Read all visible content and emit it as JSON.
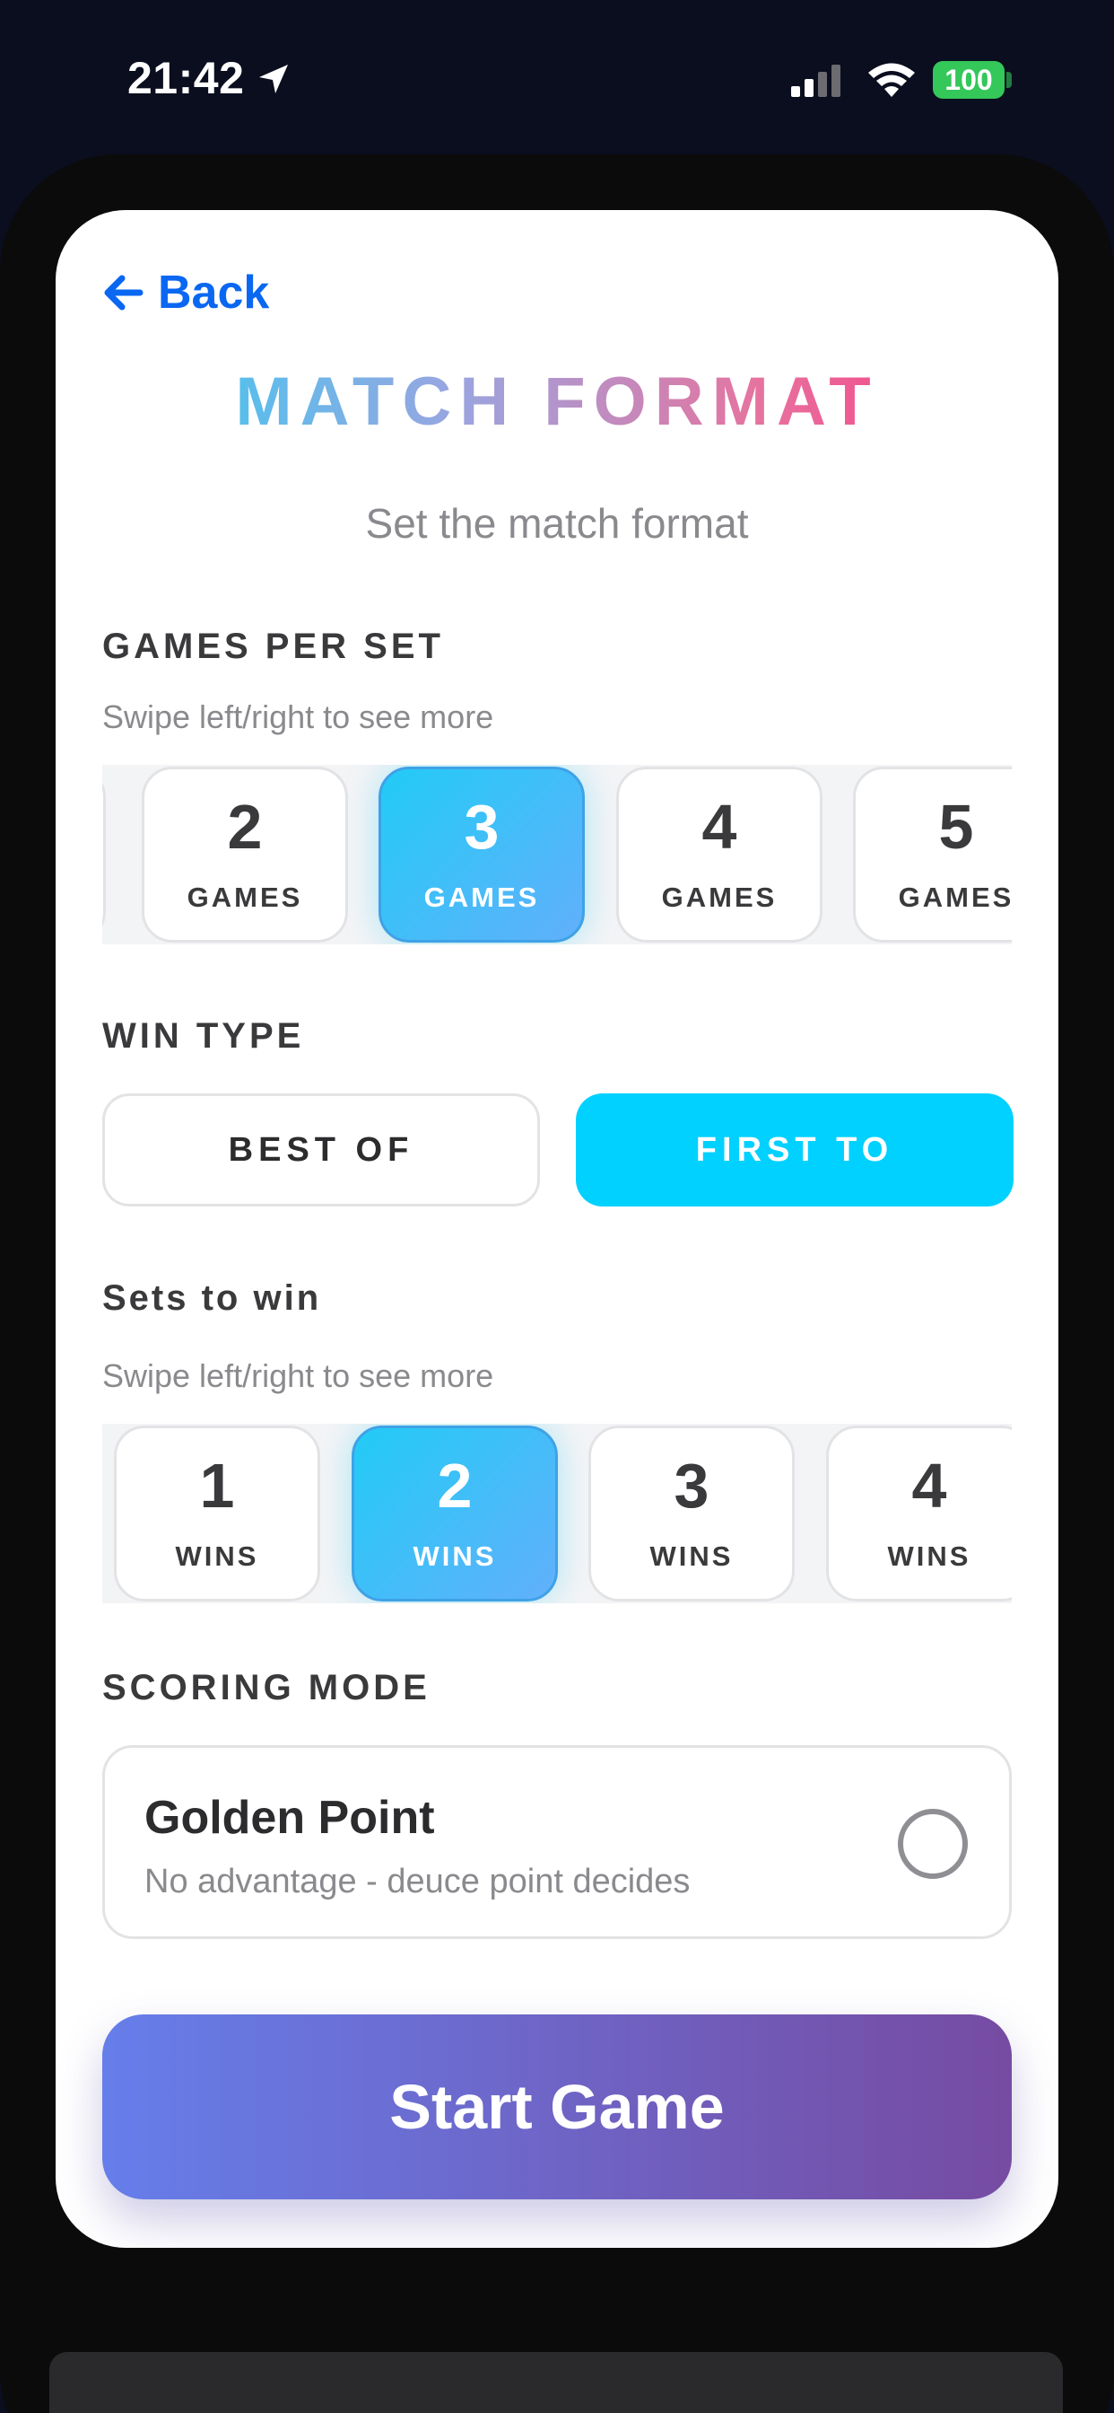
{
  "status_bar": {
    "time": "21:42",
    "battery": "100",
    "battery_color": "#34c759"
  },
  "nav": {
    "back_label": "Back"
  },
  "header": {
    "title": "MATCH FORMAT",
    "subtitle": "Set the match format"
  },
  "games_per_set": {
    "label": "GAMES PER SET",
    "hint": "Swipe left/right to see more",
    "selected": "3",
    "options": [
      {
        "value": "2",
        "label": "GAMES"
      },
      {
        "value": "3",
        "label": "GAMES"
      },
      {
        "value": "4",
        "label": "GAMES"
      },
      {
        "value": "5",
        "label": "GAMES"
      }
    ]
  },
  "win_type": {
    "label": "WIN TYPE",
    "options": [
      "BEST OF",
      "FIRST TO"
    ],
    "selected": "FIRST TO"
  },
  "sets_to_win": {
    "label": "Sets to win",
    "hint": "Swipe left/right to see more",
    "selected": "2",
    "options": [
      {
        "value": "1",
        "label": "WINS"
      },
      {
        "value": "2",
        "label": "WINS"
      },
      {
        "value": "3",
        "label": "WINS"
      },
      {
        "value": "4",
        "label": "WINS"
      }
    ]
  },
  "scoring_mode": {
    "label": "SCORING MODE",
    "option_title": "Golden Point",
    "option_desc": "No advantage - deuce point decides",
    "checked": false
  },
  "actions": {
    "start_label": "Start Game"
  },
  "colors": {
    "accent_blue": "#0a67f2",
    "selected_cyan": "#00d1ff",
    "start_gradient_from": "#667eea",
    "start_gradient_to": "#764ba2"
  }
}
